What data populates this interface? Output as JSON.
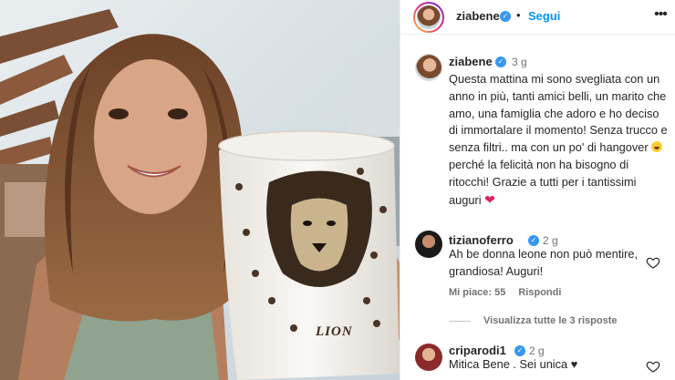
{
  "post": {
    "username": "ziabene",
    "separator": "•",
    "follow_label": "Segui",
    "more_icon": "more-horizontal-icon"
  },
  "caption": {
    "username": "ziabene",
    "time": "3 g",
    "text_1": "Questa mattina mi sono svegliata con un anno in più, tanti amici belli, un marito che amo, una famiglia che adoro e ho deciso di immortalare il momento! Senza trucco e senza filtri.. ma con un po' di hangover ",
    "text_2": "perché la felicità non ha bisogno di ritocchi! Grazie a tutti per i tantissimi auguri ",
    "heart": "❤"
  },
  "comments": [
    {
      "username": "tizianoferro",
      "time": "2 g",
      "text": "Ah be donna leone non può mentire, grandiosa! Auguri!",
      "likes_label": "Mi piace: 55",
      "reply_label": "Rispondi",
      "view_replies": "Visualizza tutte le 3 risposte"
    },
    {
      "username": "criparodi1",
      "time": "2 g",
      "text": "Mitica Bene . Sei unica ♥"
    }
  ],
  "mug": {
    "label": "LION"
  },
  "colors": {
    "link_blue": "#0095f6",
    "verified_blue": "#3897f0",
    "heart_red": "#e0245e",
    "text": "#262626",
    "muted": "#737373"
  }
}
